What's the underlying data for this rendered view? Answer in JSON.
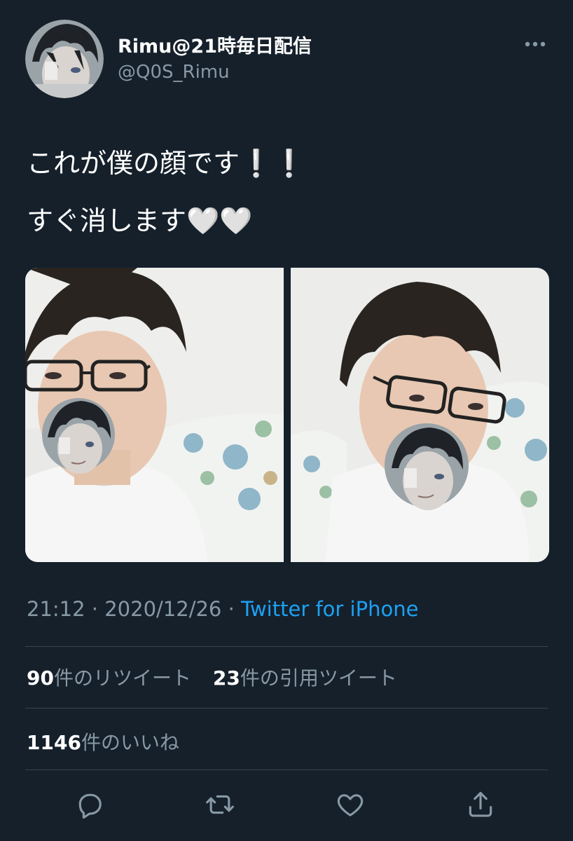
{
  "tweet": {
    "author": {
      "display_name": "Rimu@21時毎日配信",
      "handle": "@Q0S_Rimu",
      "avatar_icon": "anime-avatar"
    },
    "text_lines": [
      "これが僕の顔です❕❕",
      "すぐ消します🤍🤍"
    ],
    "media": [
      {
        "label": "photo-1"
      },
      {
        "label": "photo-2"
      }
    ],
    "meta": {
      "time": "21:12",
      "separator": "·",
      "date": "2020/12/26",
      "source": "Twitter for iPhone"
    },
    "stats": {
      "retweets": {
        "count": "90",
        "label": "件のリツイート"
      },
      "quotes": {
        "count": "23",
        "label": "件の引用ツイート"
      },
      "likes": {
        "count": "1146",
        "label": "件のいいね"
      }
    },
    "actions": [
      {
        "icon": "reply-icon"
      },
      {
        "icon": "retweet-icon"
      },
      {
        "icon": "like-icon"
      },
      {
        "icon": "share-icon"
      }
    ]
  },
  "colors": {
    "background": "#15202b",
    "primary_text": "#ffffff",
    "secondary_text": "#8899a6",
    "link": "#1da1f2",
    "divider": "#38444d"
  }
}
